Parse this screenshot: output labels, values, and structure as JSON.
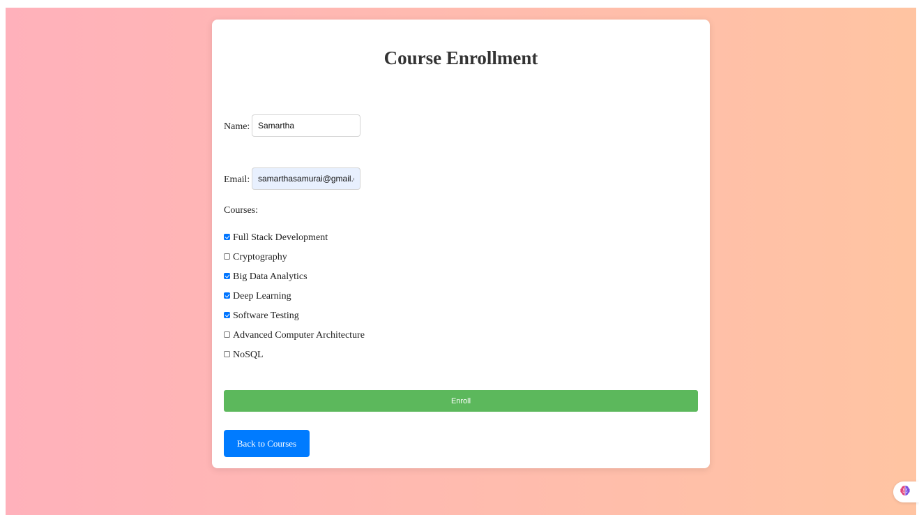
{
  "page": {
    "title": "Course Enrollment"
  },
  "form": {
    "name_label": "Name:",
    "name_value": "Samartha",
    "email_label": "Email:",
    "email_value": "samarthasamurai@gmail.com",
    "courses_label": "Courses:",
    "courses": [
      {
        "label": "Full Stack Development",
        "checked": true
      },
      {
        "label": "Cryptography",
        "checked": false
      },
      {
        "label": "Big Data Analytics",
        "checked": true
      },
      {
        "label": "Deep Learning",
        "checked": true
      },
      {
        "label": "Software Testing",
        "checked": true
      },
      {
        "label": "Advanced Computer Architecture",
        "checked": false
      },
      {
        "label": "NoSQL",
        "checked": false
      }
    ],
    "enroll_label": "Enroll",
    "back_label": "Back to Courses"
  },
  "extension": {
    "icon": "brain-icon"
  },
  "colors": {
    "enroll": "#5cb85c",
    "back": "#007bff",
    "checkbox": "#0075ff"
  }
}
